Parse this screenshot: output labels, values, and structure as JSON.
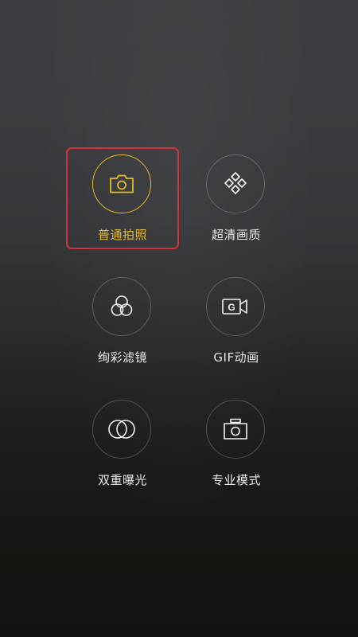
{
  "modes": [
    {
      "label": "普通拍照",
      "icon": "camera-icon",
      "active": true
    },
    {
      "label": "超清画质",
      "icon": "diamond-grid-icon",
      "active": false
    },
    {
      "label": "绚彩滤镜",
      "icon": "color-filter-icon",
      "active": false
    },
    {
      "label": "GIF动画",
      "icon": "gif-video-icon",
      "active": false
    },
    {
      "label": "双重曝光",
      "icon": "double-exposure-icon",
      "active": false
    },
    {
      "label": "专业模式",
      "icon": "pro-camera-icon",
      "active": false
    }
  ],
  "colors": {
    "active": "#e3bb27",
    "highlight_box": "#d23336",
    "label": "#e9e9e9"
  }
}
